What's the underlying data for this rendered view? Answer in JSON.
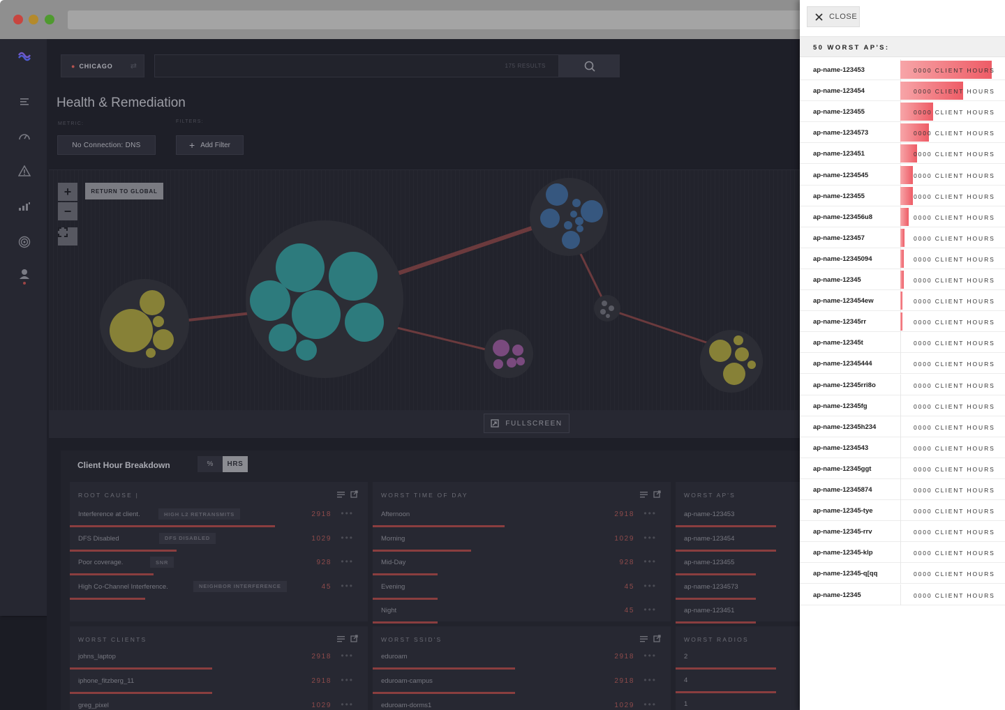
{
  "header": {
    "location": "CHICAGO",
    "results": "175 RESULTS",
    "title": "Health & Remediation",
    "metric_label": "METRIC:",
    "filters_label": "FILTERS:",
    "metric_value": "No Connection: DNS",
    "add_filter": "Add Filter"
  },
  "map": {
    "return_label": "RETURN TO GLOBAL",
    "fullscreen_label": "FULLSCREEN"
  },
  "breakdown": {
    "title": "Client Hour Breakdown",
    "toggle_pct": "%",
    "toggle_hrs": "HRS",
    "root_cause": {
      "title": "ROOT CAUSE |",
      "rows": [
        {
          "label": "Interference at client.",
          "tag": "HIGH L2 RETRANSMITS",
          "value": "2918",
          "fraction": 0.98
        },
        {
          "label": "DFS Disabled",
          "tag": "DFS DISABLED",
          "value": "1029",
          "fraction": 0.51
        },
        {
          "label": "Poor coverage.",
          "tag": "SNR",
          "value": "928",
          "fraction": 0.4
        },
        {
          "label": "High Co-Channel Interference.",
          "tag": "NEIGHBOR INTERFERENCE",
          "value": "45",
          "fraction": 0.36
        }
      ]
    },
    "worst_time": {
      "title": "WORST TIME OF DAY",
      "rows": [
        {
          "label": "Afternoon",
          "value": "2918",
          "fraction": 0.63
        },
        {
          "label": "Morning",
          "value": "1029",
          "fraction": 0.47
        },
        {
          "label": "Mid-Day",
          "value": "928",
          "fraction": 0.31
        },
        {
          "label": "Evening",
          "value": "45",
          "fraction": 0.31
        },
        {
          "label": "Night",
          "value": "45",
          "fraction": 0.31
        }
      ]
    },
    "worst_aps": {
      "title": "WORST AP'S",
      "rows": [
        {
          "label": "ap-name-123453",
          "fraction": 1.0
        },
        {
          "label": "ap-name-123454",
          "fraction": 1.0
        },
        {
          "label": "ap-name-123455",
          "fraction": 0.8
        },
        {
          "label": "ap-name-1234573",
          "fraction": 0.8
        },
        {
          "label": "ap-name-123451",
          "fraction": 0.8
        }
      ]
    },
    "worst_clients": {
      "title": "WORST CLIENTS",
      "rows": [
        {
          "label": "johns_laptop",
          "value": "2918",
          "fraction": 0.68
        },
        {
          "label": "iphone_fitzberg_11",
          "value": "2918",
          "fraction": 0.68
        },
        {
          "label": "greg_pixel",
          "value": "1029",
          "fraction": 0.3
        }
      ]
    },
    "worst_ssids": {
      "title": "WORST SSID'S",
      "rows": [
        {
          "label": "eduroam",
          "value": "2918",
          "fraction": 0.68
        },
        {
          "label": "eduroam-campus",
          "value": "2918",
          "fraction": 0.68
        },
        {
          "label": "eduroam-dorms1",
          "value": "1029",
          "fraction": 0.3
        }
      ]
    },
    "worst_radios": {
      "title": "WORST RADIOS",
      "rows": [
        {
          "label": "2",
          "fraction": 1.0
        },
        {
          "label": "4",
          "fraction": 1.0
        },
        {
          "label": "1",
          "fraction": 1.0
        }
      ]
    }
  },
  "panel": {
    "close_label": "CLOSE",
    "title": "50 WORST AP'S:",
    "value_text": "0000 CLIENT HOURS",
    "rows": [
      {
        "name": "ap-name-123453",
        "fraction": 0.87
      },
      {
        "name": "ap-name-123454",
        "fraction": 0.6
      },
      {
        "name": "ap-name-123455",
        "fraction": 0.31
      },
      {
        "name": "ap-name-1234573",
        "fraction": 0.27
      },
      {
        "name": "ap-name-123451",
        "fraction": 0.16
      },
      {
        "name": "ap-name-1234545",
        "fraction": 0.12
      },
      {
        "name": "ap-name-123455",
        "fraction": 0.12
      },
      {
        "name": "ap-name-123456u8",
        "fraction": 0.08
      },
      {
        "name": "ap-name-123457",
        "fraction": 0.04
      },
      {
        "name": "ap-name-12345094",
        "fraction": 0.03
      },
      {
        "name": "ap-name-12345",
        "fraction": 0.03
      },
      {
        "name": "ap-name-123454ew",
        "fraction": 0.015
      },
      {
        "name": "ap-name-12345rr",
        "fraction": 0.015
      },
      {
        "name": "ap-name-12345t",
        "fraction": 0
      },
      {
        "name": "ap-name-12345444",
        "fraction": 0
      },
      {
        "name": "ap-name-12345rri8o",
        "fraction": 0
      },
      {
        "name": "ap-name-12345fg",
        "fraction": 0
      },
      {
        "name": "ap-name-12345h234",
        "fraction": 0
      },
      {
        "name": "ap-name-1234543",
        "fraction": 0
      },
      {
        "name": "ap-name-12345ggt",
        "fraction": 0
      },
      {
        "name": "ap-name-12345874",
        "fraction": 0
      },
      {
        "name": "ap-name-12345-tye",
        "fraction": 0
      },
      {
        "name": "ap-name-12345-rrv",
        "fraction": 0
      },
      {
        "name": "ap-name-12345-klp",
        "fraction": 0
      },
      {
        "name": "ap-name-12345-q[qq",
        "fraction": 0
      },
      {
        "name": "ap-name-12345",
        "fraction": 0
      }
    ]
  },
  "colors": {
    "accent_red": "#ee5c66",
    "bar_red": "#8a3e3f",
    "teal": "#2f7f80",
    "olive": "#8b8534",
    "blue": "#3a5b85",
    "purple": "#7b4b7f"
  }
}
